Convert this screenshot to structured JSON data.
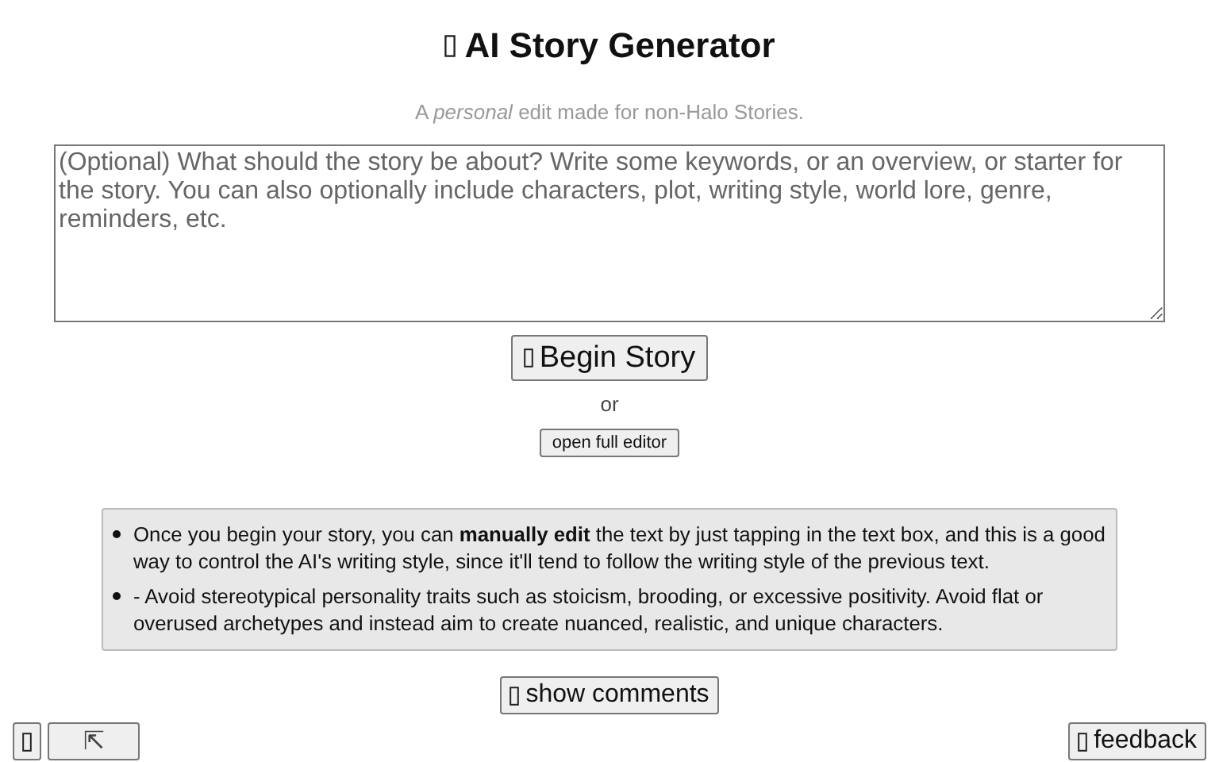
{
  "title": "AI Story Generator",
  "subtitle": "A *personal* edit made for non-Halo Stories.",
  "story_field": {
    "placeholder": "(Optional) What should the story be about? Write some keywords, or an overview, or starter for the story. You can also optionally include characters, plot, writing style, world lore, genre, reminders, etc."
  },
  "begin_button": "Begin Story",
  "or_text": "or",
  "editor_button": "open full editor",
  "notes": [
    "Once you begin your story, you can **manually edit** the text by just tapping in the text box, and this is a good way to control the AI's writing style, since it'll tend to follow the writing style of the previous text.",
    "- Avoid stereotypical personality traits such as stoicism, brooding, or excessive positivity. Avoid flat or overused archetypes and instead aim to create nuanced, realistic, and unique characters."
  ],
  "comments_button": "show comments",
  "corner_button": "⇱",
  "feedback_button": "feedback"
}
